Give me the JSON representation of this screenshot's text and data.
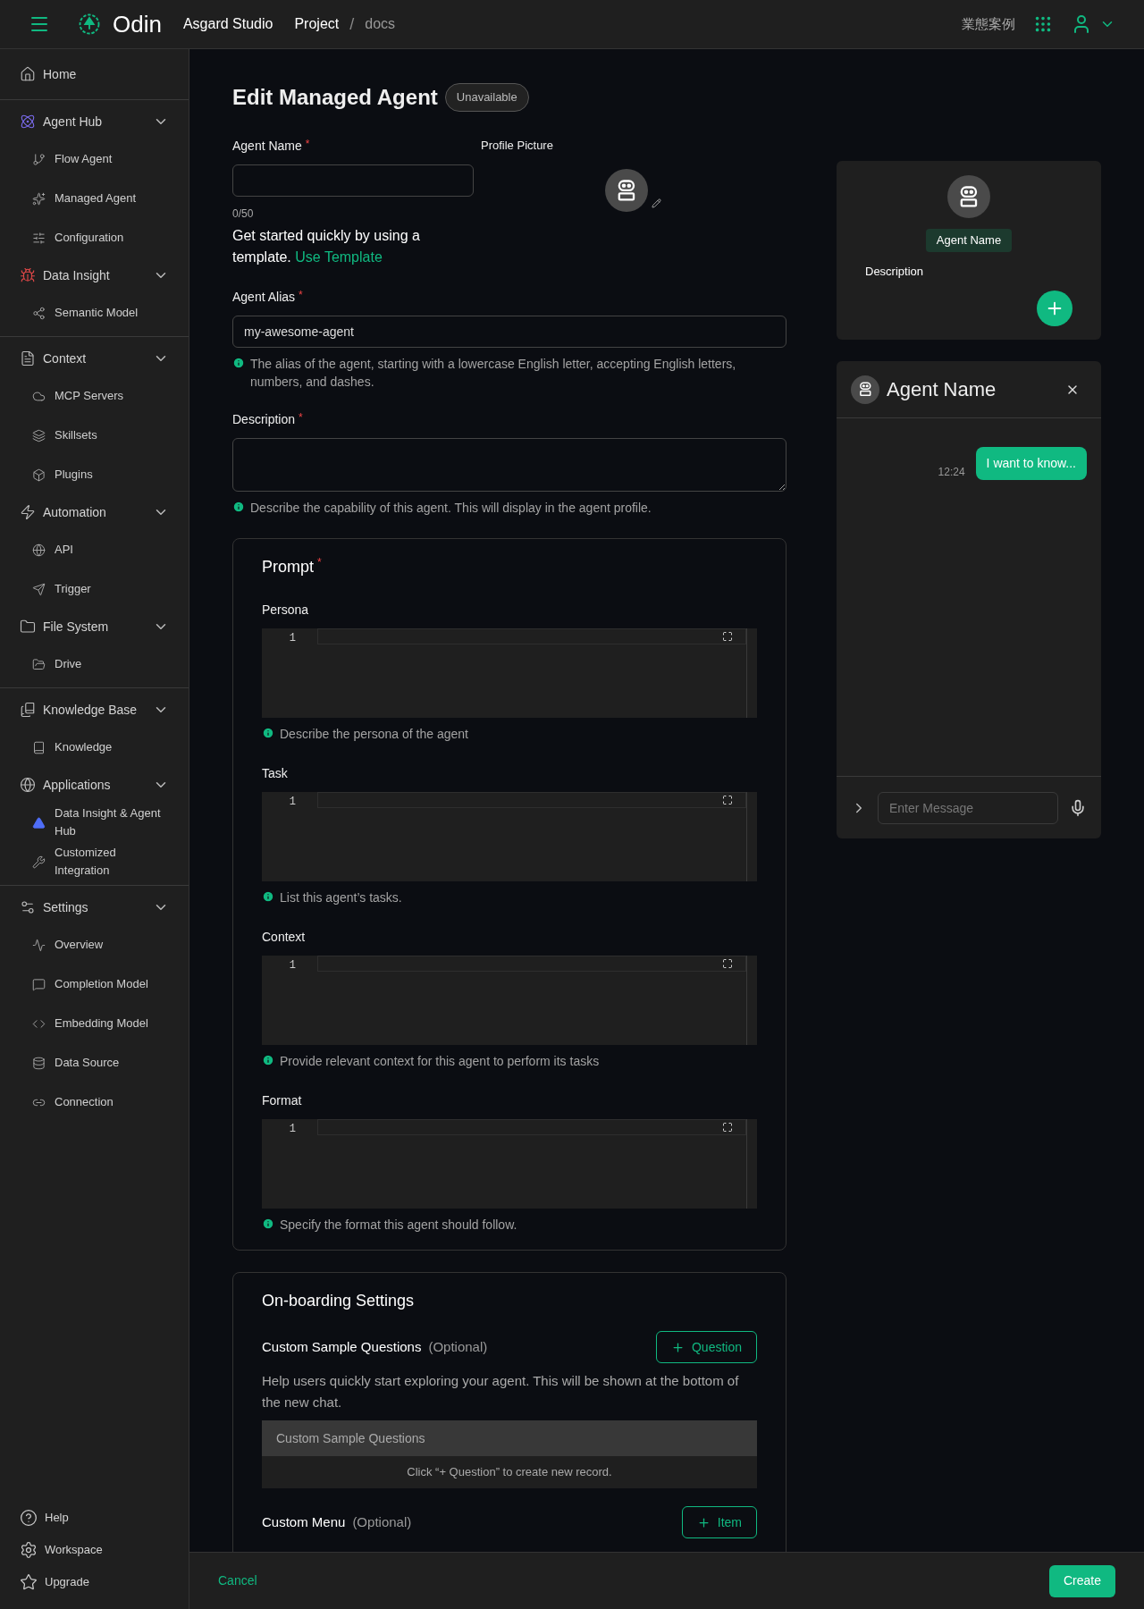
{
  "topbar": {
    "brand": "Odin",
    "workspace": "Asgard Studio",
    "breadcrumb": [
      "Project",
      "docs"
    ],
    "breadcrumb_separator": "/",
    "case_link": "業態案例"
  },
  "sidebar": {
    "sections": [
      [
        {
          "label": "Home"
        }
      ],
      [
        {
          "label": "Agent Hub",
          "expanded": true,
          "children": [
            {
              "label": "Flow Agent"
            },
            {
              "label": "Managed Agent"
            },
            {
              "label": "Configuration"
            }
          ]
        },
        {
          "label": "Data Insight",
          "expanded": true,
          "children": [
            {
              "label": "Semantic Model"
            }
          ]
        }
      ],
      [
        {
          "label": "Context",
          "expanded": true,
          "children": [
            {
              "label": "MCP Servers"
            },
            {
              "label": "Skillsets"
            },
            {
              "label": "Plugins"
            }
          ]
        },
        {
          "label": "Automation",
          "expanded": true,
          "children": [
            {
              "label": "API"
            },
            {
              "label": "Trigger"
            }
          ]
        },
        {
          "label": "File System",
          "expanded": true,
          "children": [
            {
              "label": "Drive"
            }
          ]
        }
      ],
      [
        {
          "label": "Knowledge Base",
          "expanded": true,
          "children": [
            {
              "label": "Knowledge"
            }
          ]
        },
        {
          "label": "Applications",
          "expanded": true,
          "children": [
            {
              "label": "Data Insight & Agent Hub"
            },
            {
              "label": "Customized Integration"
            }
          ]
        }
      ],
      [
        {
          "label": "Settings",
          "expanded": true,
          "children": [
            {
              "label": "Overview"
            },
            {
              "label": "Completion Model"
            },
            {
              "label": "Embedding Model"
            },
            {
              "label": "Data Source"
            },
            {
              "label": "Connection"
            }
          ]
        }
      ]
    ],
    "footer": [
      {
        "label": "Help"
      },
      {
        "label": "Workspace"
      },
      {
        "label": "Upgrade"
      }
    ]
  },
  "page": {
    "title": "Edit Managed Agent",
    "status": "Unavailable"
  },
  "agent_name": {
    "label": "Agent Name",
    "required": "*",
    "counter": "0/50"
  },
  "template_hint": {
    "text": "Get started quickly by using a template.",
    "link": "Use Template"
  },
  "profile_picture": {
    "label": "Profile Picture"
  },
  "alias": {
    "label": "Agent Alias",
    "required": "*",
    "value": "my-awesome-agent",
    "help": "The alias of the agent, starting with a lowercase English letter, accepting English letters, numbers, and dashes."
  },
  "description": {
    "label": "Description",
    "required": "*",
    "help": "Describe the capability of this agent. This will display in the agent profile."
  },
  "prompt": {
    "title": "Prompt",
    "required": "*",
    "editors": [
      {
        "label": "Persona",
        "line": "1",
        "help": "Describe the persona of the agent"
      },
      {
        "label": "Task",
        "line": "1",
        "help": "List this agent’s tasks."
      },
      {
        "label": "Context",
        "line": "1",
        "help": "Provide relevant context for this agent to perform its tasks"
      },
      {
        "label": "Format",
        "line": "1",
        "help": "Specify the format this agent should follow."
      }
    ]
  },
  "onboarding": {
    "title": "On-boarding Settings",
    "sections": [
      {
        "label": "Custom Sample Questions",
        "optional": "(Optional)",
        "button": "Question",
        "description": "Help users quickly start exploring your agent. This will be shown at the bottom of the new chat.",
        "table": {
          "header": "Custom Sample Questions",
          "empty": "Click “+ Question” to create new record."
        }
      },
      {
        "label": "Custom Menu",
        "optional": "(Optional)",
        "button": "Item"
      }
    ]
  },
  "preview": {
    "name": "Agent Name",
    "description": "Description"
  },
  "chat": {
    "title": "Agent Name",
    "messages": [
      {
        "time": "12:24",
        "text": "I want to know..."
      }
    ],
    "placeholder": "Enter Message"
  },
  "actions": {
    "cancel": "Cancel",
    "create": "Create"
  }
}
